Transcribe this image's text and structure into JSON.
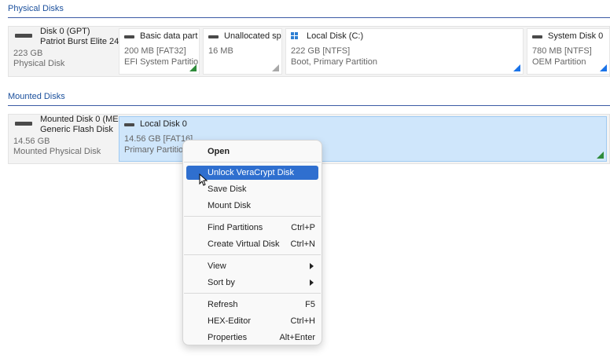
{
  "physical_section": {
    "title": "Physical Disks"
  },
  "disk0": {
    "name": "Disk 0 (GPT)",
    "model": "Patriot Burst Elite 24",
    "size": "223 GB",
    "kind": "Physical Disk",
    "partitions": [
      {
        "name": "Basic data part",
        "line2": "200 MB [FAT32]",
        "line3": "EFI System Partitio",
        "corner": "green"
      },
      {
        "name": "Unallocated sp",
        "line2": "16 MB",
        "line3": "",
        "corner": "gray"
      },
      {
        "name": "Local Disk (C:)",
        "line2": "222 GB [NTFS]",
        "line3": "Boot, Primary Partition",
        "corner": "blue",
        "icon": "windows-icon"
      },
      {
        "name": "System Disk 0",
        "line2": "780 MB [NTFS]",
        "line3": "OEM Partition",
        "corner": "blue"
      }
    ]
  },
  "mounted_section": {
    "title": "Mounted Disks"
  },
  "mounted_disk": {
    "name": "Mounted Disk 0 (ME",
    "model": "Generic Flash Disk",
    "size": "14.56 GB",
    "kind": "Mounted Physical Disk",
    "partition": {
      "name": "Local Disk 0",
      "line2": "14.56 GB [FAT16]",
      "line3": "Primary Partitio",
      "corner": "green"
    }
  },
  "context_menu": {
    "items": [
      {
        "label": "Open",
        "shortcut": "",
        "bold": true
      },
      {
        "label": "Unlock VeraCrypt Disk",
        "shortcut": "",
        "highlighted": true
      },
      {
        "label": "Save Disk",
        "shortcut": ""
      },
      {
        "label": "Mount Disk",
        "shortcut": ""
      },
      {
        "label": "Find Partitions",
        "shortcut": "Ctrl+P"
      },
      {
        "label": "Create Virtual Disk",
        "shortcut": "Ctrl+N"
      },
      {
        "label": "View",
        "shortcut": "",
        "submenu": true
      },
      {
        "label": "Sort by",
        "shortcut": "",
        "submenu": true
      },
      {
        "label": "Refresh",
        "shortcut": "F5"
      },
      {
        "label": "HEX-Editor",
        "shortcut": "Ctrl+H"
      },
      {
        "label": "Properties",
        "shortcut": "Alt+Enter"
      }
    ]
  },
  "colors": {
    "accent": "#1a4f9c",
    "selection": "#cfe6fb",
    "menu_highlight": "#2f6fcf",
    "corner_blue": "#1a73e8",
    "corner_green": "#2e8b3a"
  }
}
